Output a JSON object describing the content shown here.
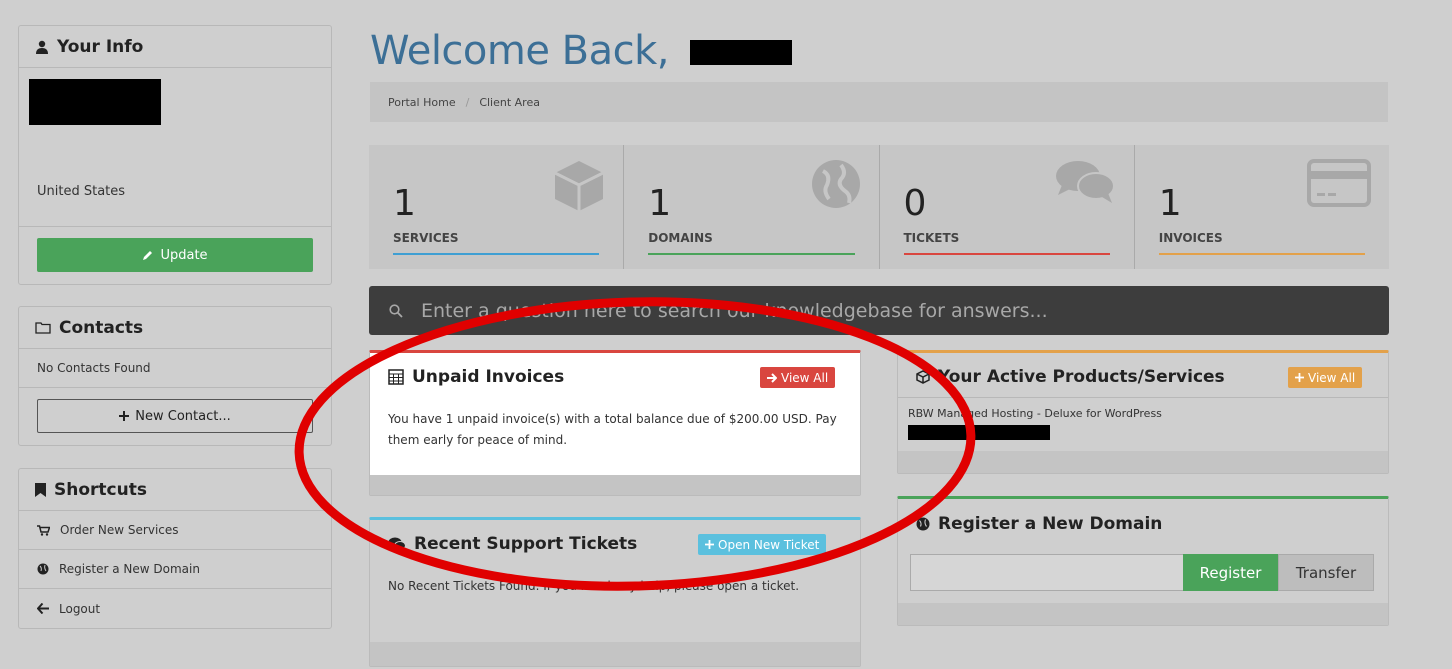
{
  "sidebar": {
    "your_info": {
      "title": "Your Info",
      "country": "United States",
      "update_label": "Update"
    },
    "contacts": {
      "title": "Contacts",
      "empty_text": "No Contacts Found",
      "new_contact_label": "New Contact..."
    },
    "shortcuts": {
      "title": "Shortcuts",
      "items": [
        {
          "label": "Order New Services",
          "icon": "cart-icon"
        },
        {
          "label": "Register a New Domain",
          "icon": "globe-icon"
        },
        {
          "label": "Logout",
          "icon": "arrow-left-icon"
        }
      ]
    }
  },
  "header": {
    "welcome": "Welcome Back,",
    "breadcrumb": [
      "Portal Home",
      "/",
      "Client Area"
    ]
  },
  "stats": [
    {
      "value": "1",
      "label": "SERVICES",
      "color": "#3f9fd3",
      "icon": "cube-icon"
    },
    {
      "value": "1",
      "label": "DOMAINS",
      "color": "#4aa35a",
      "icon": "globe-icon"
    },
    {
      "value": "0",
      "label": "TICKETS",
      "color": "#d9463f",
      "icon": "comments-icon"
    },
    {
      "value": "1",
      "label": "INVOICES",
      "color": "#e3a14a",
      "icon": "credit-card-icon"
    }
  ],
  "search": {
    "placeholder": "Enter a question here to search our knowledgebase for answers..."
  },
  "unpaid_invoices": {
    "title": "Unpaid Invoices",
    "button": "View All",
    "body": "You have 1 unpaid invoice(s) with a total balance due of $200.00 USD. Pay them early for peace of mind."
  },
  "support_tickets": {
    "title": "Recent Support Tickets",
    "button": "Open New Ticket",
    "body": "No Recent Tickets Found. If you need any help, please open a ticket."
  },
  "active_products": {
    "title": "Your Active Products/Services",
    "button": "View All",
    "item": "RBW Managed Hosting - Deluxe for WordPress"
  },
  "register_domain": {
    "title": "Register a New Domain",
    "register_label": "Register",
    "transfer_label": "Transfer"
  },
  "colors": {
    "accent_blue": "#3c6f96",
    "success": "#4aa35a",
    "danger": "#d9463f",
    "warning": "#e3a14a",
    "info": "#5bc0de",
    "annotation_red": "#e00000"
  }
}
